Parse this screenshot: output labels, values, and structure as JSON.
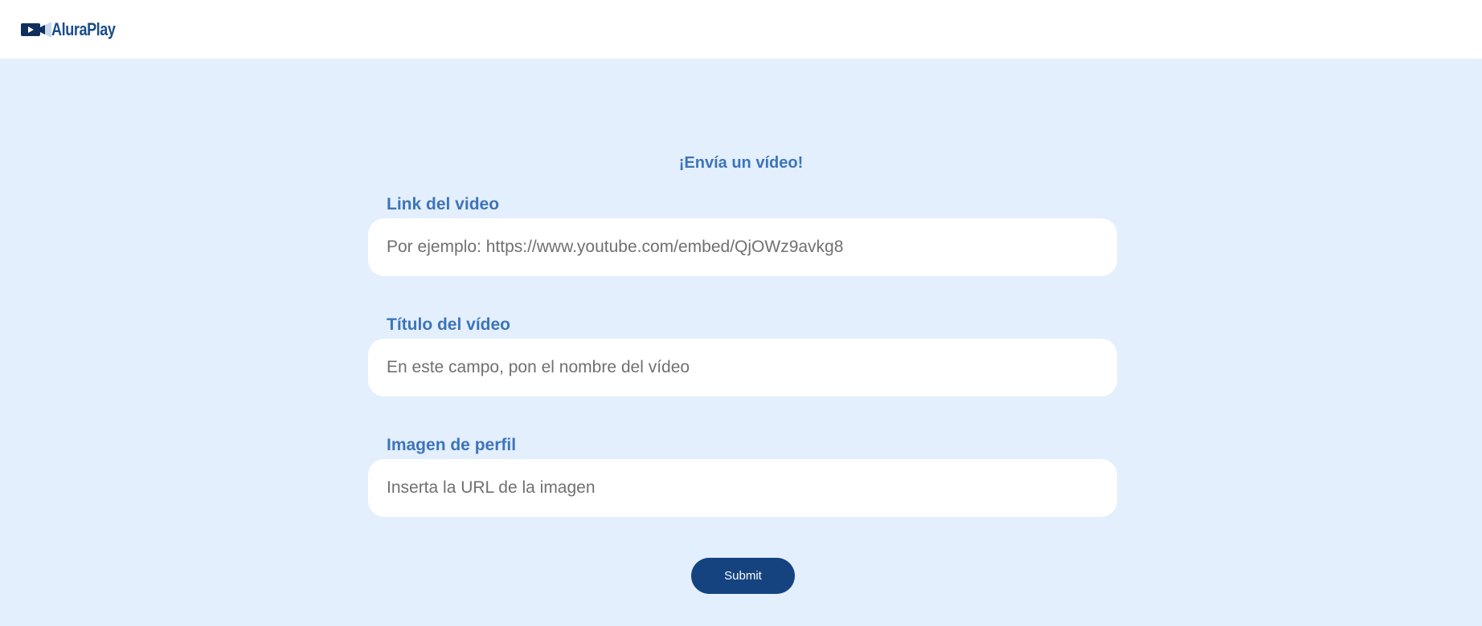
{
  "header": {
    "logo_text": "AluraPlay",
    "logo_icon": "video-camera-icon"
  },
  "form": {
    "title": "¡Envía un vídeo!",
    "fields": [
      {
        "label": "Link del video",
        "placeholder": "Por ejemplo: https://www.youtube.com/embed/QjOWz9avkg8",
        "value": ""
      },
      {
        "label": "Título del vídeo",
        "placeholder": "En este campo, pon el nombre del vídeo",
        "value": ""
      },
      {
        "label": "Imagen de perfil",
        "placeholder": "Inserta la URL de la imagen",
        "value": ""
      }
    ],
    "submit_label": "Submit"
  },
  "colors": {
    "page_background": "#e3effd",
    "header_background": "#ffffff",
    "label_color": "#3d74b9",
    "button_background": "#144380",
    "logo_color": "#1a4c8a"
  }
}
